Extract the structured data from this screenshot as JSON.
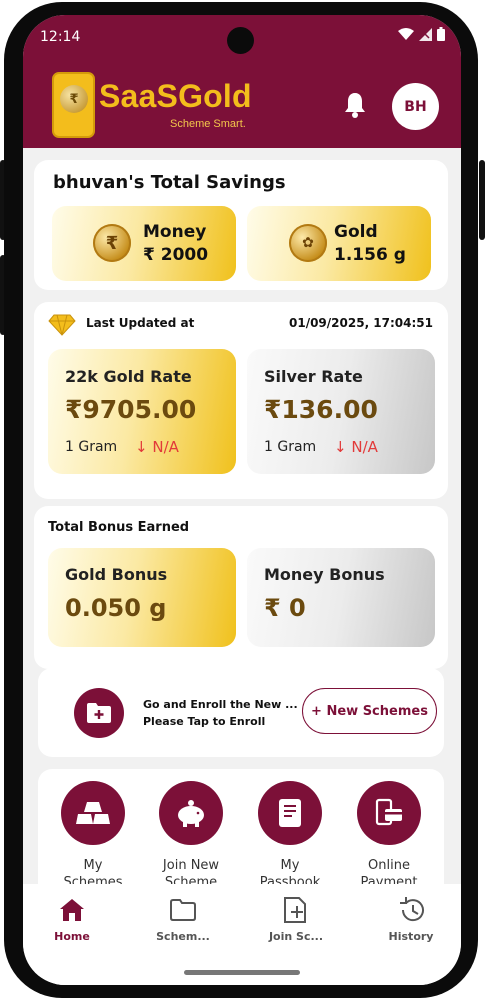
{
  "status_bar": {
    "time": "12:14"
  },
  "header": {
    "app_name": "SaaSGold",
    "tagline": "Scheme Smart.",
    "avatar_initials": "BH",
    "brand_color": "#7c1038",
    "accent_color": "#f3bd1c",
    "icons": [
      "bell-icon"
    ]
  },
  "savings": {
    "title": "bhuvan's Total Savings",
    "money_label": "Money",
    "money_value": "₹ 2000",
    "gold_label": "Gold",
    "gold_value": "1.156 g"
  },
  "rates": {
    "last_updated_label": "Last Updated at",
    "last_updated_value": "01/09/2025, 17:04:51",
    "gold": {
      "title": "22k Gold Rate",
      "value": "₹9705.00",
      "unit": "1 Gram",
      "change": "N/A"
    },
    "silver": {
      "title": "Silver Rate",
      "value": "₹136.00",
      "unit": "1 Gram",
      "change": "N/A"
    }
  },
  "bonus": {
    "title": "Total Bonus Earned",
    "gold": {
      "title": "Gold Bonus",
      "value": "0.050 g"
    },
    "money": {
      "title": "Money Bonus",
      "value": "₹ 0"
    }
  },
  "enroll": {
    "line1": "Go and Enroll the New ...",
    "line2": "Please Tap to Enroll",
    "button_label": "+ New Schemes"
  },
  "quick_actions": [
    {
      "line1": "My",
      "line2": "Schemes"
    },
    {
      "line1": "Join New",
      "line2": "Scheme"
    },
    {
      "line1": "My",
      "line2": "Passbook"
    },
    {
      "line1": "Online",
      "line2": "Payment"
    }
  ],
  "bottom_nav": [
    {
      "label": "Home",
      "active": true
    },
    {
      "label": "Schem...",
      "active": false
    },
    {
      "label": "Join Sc...",
      "active": false
    },
    {
      "label": "History",
      "active": false
    }
  ]
}
